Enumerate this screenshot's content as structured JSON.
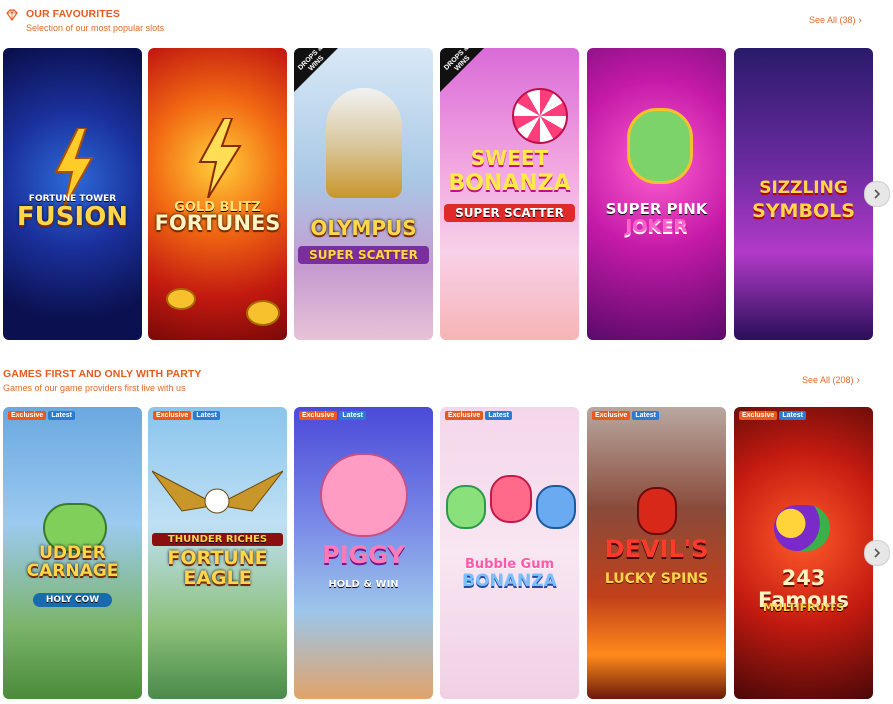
{
  "colors": {
    "accent": "#e85a1b",
    "badge_exclusive": "#e8591b",
    "badge_latest": "#2a7bd3"
  },
  "favourites": {
    "title": "OUR FAVOURITES",
    "subtitle": "Selection of our most popular slots",
    "see_all": "See All (38)",
    "icon": "diamond-icon",
    "games": [
      {
        "title": "FUSION",
        "sub": "FORTUNE TOWER"
      },
      {
        "title": "FORTUNES",
        "sub": "GOLD BLITZ"
      },
      {
        "title": "OLYMPUS",
        "sub": "SUPER SCATTER",
        "tag": "DROPS & WINS"
      },
      {
        "title": "BONANZA",
        "sub": "SUPER SCATTER",
        "tag": "DROPS & WINS",
        "top": "SWEET"
      },
      {
        "title": "JOKER",
        "sub": "SUPER PINK"
      },
      {
        "title": "SYMBOLS",
        "sub": "SIZZLING"
      }
    ]
  },
  "first": {
    "title": "GAMES FIRST AND ONLY WITH PARTY",
    "subtitle": "Games of our game providers first live with us",
    "see_all": "See All (208)",
    "badge_exclusive": "Exclusive",
    "badge_latest": "Latest",
    "games": [
      {
        "title": "UDDER CARNAGE",
        "sub": "HOLY COW"
      },
      {
        "title": "FORTUNE EAGLE",
        "sub": "THUNDER RICHES"
      },
      {
        "title": "PIGGY",
        "sub": "HOLD & WIN"
      },
      {
        "title": "BONANZA",
        "sub": "Bubble Gum"
      },
      {
        "title": "DEVIL'S",
        "sub": "LUCKY SPINS"
      },
      {
        "title": "243 Famous",
        "sub": "MULTIFRUITS"
      }
    ]
  }
}
